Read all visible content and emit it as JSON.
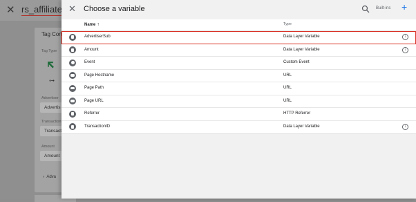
{
  "background": {
    "title": "rs_affiliate_tag",
    "card_title": "Tag Conf",
    "fields": [
      {
        "label": "Tag Type"
      },
      {
        "label": "Advertiser",
        "value": "Advertis"
      },
      {
        "label": "Transaction",
        "value": "Transact"
      },
      {
        "label": "Amount",
        "value": "Amount"
      }
    ],
    "advanced_label": "Adva"
  },
  "drawer": {
    "title": "Choose a variable",
    "builtins_label": "Built-ins",
    "plus_symbol": "+",
    "close_symbol": "✕"
  },
  "table": {
    "col_name": "Name",
    "sort_arrow": "↑",
    "col_type": "Type",
    "rows": [
      {
        "name": "AdvertiserSub",
        "type": "Data Layer Variable",
        "icon": "doc-icon",
        "info": true,
        "selected": true
      },
      {
        "name": "Amount",
        "type": "Data Layer Variable",
        "icon": "doc-icon",
        "info": true,
        "selected": false
      },
      {
        "name": "Event",
        "type": "Custom Event",
        "icon": "event-icon",
        "info": false,
        "selected": false
      },
      {
        "name": "Page Hostname",
        "type": "URL",
        "icon": "url-icon",
        "info": false,
        "selected": false
      },
      {
        "name": "Page Path",
        "type": "URL",
        "icon": "url-icon",
        "info": false,
        "selected": false
      },
      {
        "name": "Page URL",
        "type": "URL",
        "icon": "url-icon",
        "info": false,
        "selected": false
      },
      {
        "name": "Referrer",
        "type": "HTTP Referrer",
        "icon": "doc-icon",
        "info": false,
        "selected": false
      },
      {
        "name": "TransactionID",
        "type": "Data Layer Variable",
        "icon": "doc-icon",
        "info": true,
        "selected": false
      }
    ]
  },
  "colors": {
    "accent": "#1a73e8",
    "selected_outline": "#d93025"
  }
}
